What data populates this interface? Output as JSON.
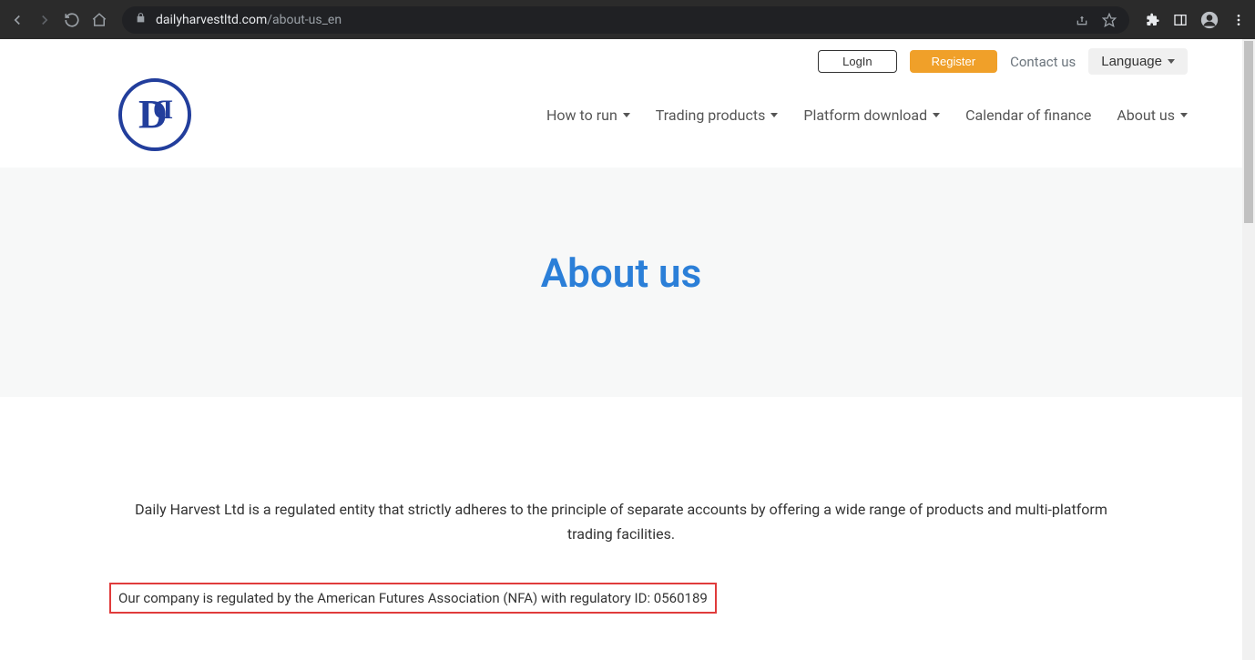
{
  "browser": {
    "url_host": "dailyharvestltd.com",
    "url_path": "/about-us_en"
  },
  "topbar": {
    "login_label": "LogIn",
    "register_label": "Register",
    "contact_label": "Contact us",
    "language_label": "Language"
  },
  "nav": {
    "items": [
      {
        "label": "How to run",
        "has_dropdown": true
      },
      {
        "label": "Trading products",
        "has_dropdown": true
      },
      {
        "label": "Platform download",
        "has_dropdown": true
      },
      {
        "label": "Calendar of finance",
        "has_dropdown": false
      },
      {
        "label": "About us",
        "has_dropdown": true
      }
    ]
  },
  "hero": {
    "title": "About us"
  },
  "main": {
    "intro_paragraph": "Daily Harvest Ltd is a regulated entity that strictly adheres to the principle of separate accounts by offering a wide range of products and multi-platform trading facilities.",
    "regulator_line": "Our company is regulated by the American Futures Association (NFA) with regulatory ID: 0560189"
  }
}
